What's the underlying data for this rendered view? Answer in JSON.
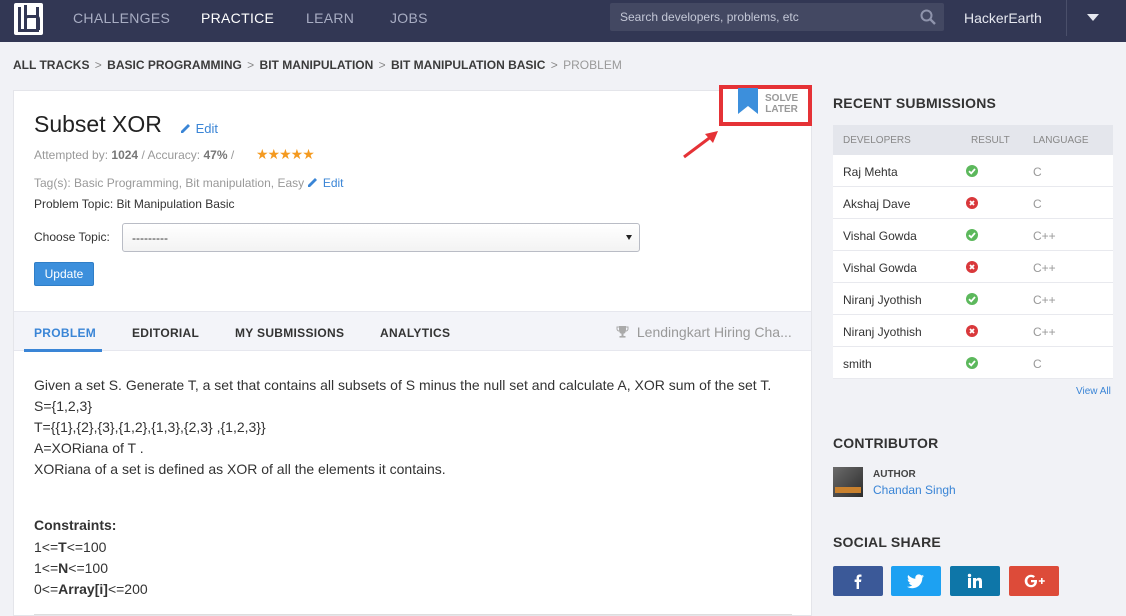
{
  "nav": {
    "links": [
      "CHALLENGES",
      "PRACTICE",
      "LEARN",
      "JOBS"
    ],
    "active": "PRACTICE",
    "search_placeholder": "Search developers, problems, etc",
    "user": "HackerEarth"
  },
  "breadcrumb": {
    "items": [
      "ALL TRACKS",
      "BASIC PROGRAMMING",
      "BIT MANIPULATION",
      "BIT MANIPULATION BASIC"
    ],
    "separator": ">",
    "current": "PROBLEM"
  },
  "problem": {
    "title": "Subset XOR",
    "edit_label": "Edit",
    "attempted_label": "Attempted by:",
    "attempted_count": "1024",
    "accuracy_label": "Accuracy:",
    "accuracy_value": "47%",
    "divider": "/",
    "rating_stars": 5,
    "stars_text": "★★★★★",
    "tags_prefix": "Tag(s):",
    "tags": "Basic Programming, Bit manipulation, Easy",
    "topic_label": "Problem Topic:",
    "topic": "Bit Manipulation Basic",
    "choose_topic_label": "Choose Topic:",
    "choose_topic_value": "---------",
    "update_label": "Update",
    "solve_later": [
      "SOLVE",
      "LATER"
    ]
  },
  "tabs": {
    "items": [
      "PROBLEM",
      "EDITORIAL",
      "MY SUBMISSIONS",
      "ANALYTICS"
    ],
    "active": "PROBLEM",
    "contest": "Lendingkart Hiring Cha..."
  },
  "statement": {
    "lines": [
      "Given a set S. Generate T, a set that contains all subsets of S minus the null set and calculate A, XOR sum of the set T.",
      "S={1,2,3}",
      "T={{1},{2},{3},{1,2},{1,3},{2,3} ,{1,2,3}}",
      "A=XORiana of T .",
      "XORiana of a set is defined as XOR of all the elements it contains."
    ],
    "constraints_title": "Constraints:",
    "constraints": [
      {
        "pre": "1<=",
        "bold": "T",
        "post": "<=100"
      },
      {
        "pre": "1<=",
        "bold": "N",
        "post": "<=100"
      },
      {
        "pre": "0<=",
        "bold": "Array[i]",
        "post": "<=200"
      }
    ]
  },
  "recent_submissions": {
    "title": "RECENT SUBMISSIONS",
    "headers": [
      "DEVELOPERS",
      "RESULT",
      "LANGUAGE"
    ],
    "rows": [
      {
        "developer": "Raj Mehta",
        "result": "accepted",
        "language": "C"
      },
      {
        "developer": "Akshaj Dave",
        "result": "wrong",
        "language": "C"
      },
      {
        "developer": "Vishal Gowda",
        "result": "accepted",
        "language": "C++"
      },
      {
        "developer": "Vishal Gowda",
        "result": "wrong",
        "language": "C++"
      },
      {
        "developer": "Niranj Jyothish",
        "result": "accepted",
        "language": "C++"
      },
      {
        "developer": "Niranj Jyothish",
        "result": "wrong",
        "language": "C++"
      },
      {
        "developer": "smith",
        "result": "accepted",
        "language": "C"
      }
    ],
    "view_all": "View All"
  },
  "contributor": {
    "title": "CONTRIBUTOR",
    "role": "AUTHOR",
    "name": "Chandan Singh"
  },
  "social": {
    "title": "SOCIAL SHARE",
    "buttons": [
      {
        "name": "facebook",
        "color": "#3b5998"
      },
      {
        "name": "twitter",
        "color": "#1da1f2"
      },
      {
        "name": "linkedin",
        "color": "#0e76a8"
      },
      {
        "name": "google-plus",
        "color": "#dd4b39"
      }
    ]
  },
  "colors": {
    "navbar": "#323754",
    "accent": "#3a85d6",
    "highlight_box": "#e53236",
    "star": "#f49a20"
  }
}
